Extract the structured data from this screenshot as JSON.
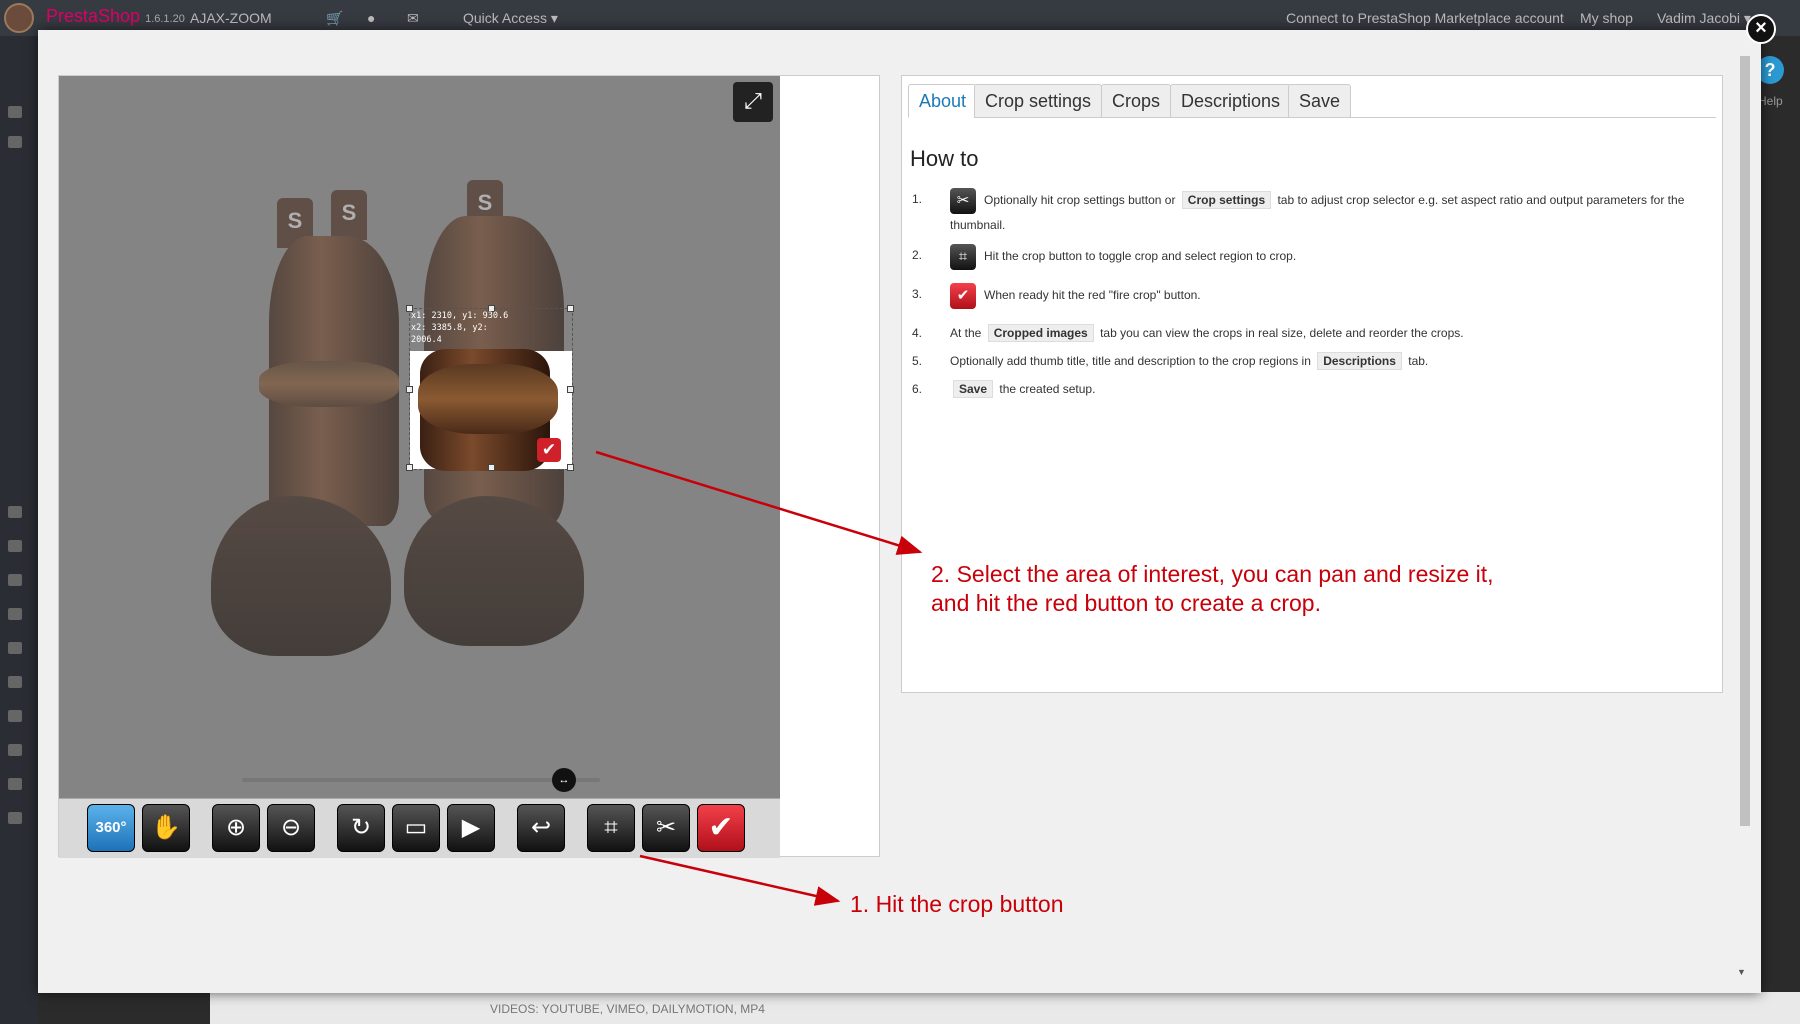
{
  "topbar": {
    "brand": "PrestaShop",
    "version": "1.6.1.20",
    "shop_name": "AJAX-ZOOM",
    "quick_access": "Quick Access",
    "marketplace": "Connect to PrestaShop Marketplace account",
    "my_shop": "My shop",
    "user": "Vadim Jacobi"
  },
  "background": {
    "help": "Help",
    "videos_label": "VIDEOS: YOUTUBE, VIMEO, DAILYMOTION, MP4"
  },
  "viewer": {
    "crop_coords_line1": "x1: 2310, y1: 930.6",
    "crop_coords_line2": "x2: 3385.8, y2:",
    "crop_coords_line3": "2006.4",
    "pull_tab_letter": "S",
    "toolbar": {
      "btn_360": "360°"
    }
  },
  "panel": {
    "tabs": [
      "About",
      "Crop settings",
      "Crops",
      "Descriptions",
      "Save"
    ],
    "active_tab": "About",
    "heading": "How to",
    "steps": {
      "s1_num": "1.",
      "s1_pre": "Optionally hit crop settings button or",
      "s1_kbd": "Crop settings",
      "s1_post": "tab to adjust crop selector e.g. set aspect ratio and output parameters for the thumbnail.",
      "s2_num": "2.",
      "s2_text": "Hit the crop button to toggle crop and select region to crop.",
      "s3_num": "3.",
      "s3_text": "When ready hit the red \"fire crop\" button.",
      "s4_num": "4.",
      "s4_pre": "At the",
      "s4_kbd": "Cropped images",
      "s4_post": "tab you can view the crops in real size, delete and reorder the crops.",
      "s5_num": "5.",
      "s5_pre": "Optionally add thumb title, title and description to the crop regions in",
      "s5_kbd": "Descriptions",
      "s5_post": "tab.",
      "s6_num": "6.",
      "s6_kbd": "Save",
      "s6_post": "the created setup."
    }
  },
  "annotations": {
    "a2_line1": "2. Select the area of interest, you can pan and resize it,",
    "a2_line2": "and hit the red button to create a crop.",
    "a1": "1. Hit the crop button"
  },
  "colors": {
    "annotation": "#c8000a",
    "active_tab": "#1a7ab8",
    "fire_button": "#d0202a",
    "btn_360": "#2b8fd6"
  },
  "icons": {
    "close": "close-icon",
    "fullscreen": "expand-icon",
    "pan": "hand-icon",
    "zoom_in": "zoom-in-icon",
    "zoom_out": "zoom-out-icon",
    "rotate": "reset-icon",
    "screen": "screen-icon",
    "play": "play-icon",
    "undo": "undo-icon",
    "crop": "crop-icon",
    "settings": "tools-icon",
    "fire": "checkmark-icon"
  }
}
